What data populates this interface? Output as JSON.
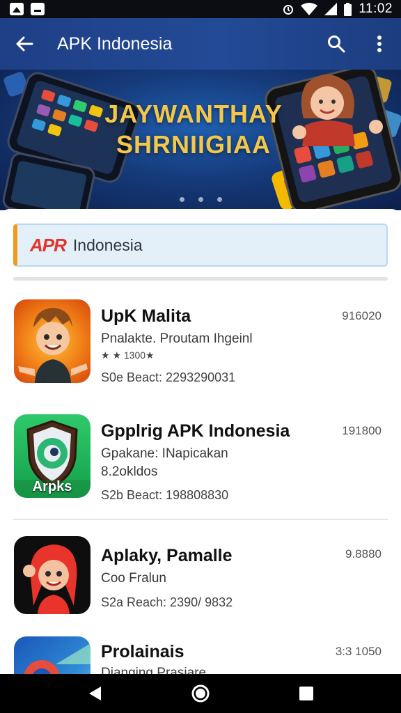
{
  "status_bar": {
    "time": "11:02",
    "left_icons": [
      "image-icon",
      "message-icon"
    ],
    "right_icons": [
      "alarm-icon",
      "wifi-icon",
      "signal-icon",
      "battery-icon"
    ]
  },
  "app_bar": {
    "title": "APK Indonesia",
    "back_icon": "arrow-back-icon",
    "search_icon": "search-icon",
    "menu_icon": "more-vert-icon",
    "color": "#234a96"
  },
  "banner": {
    "title_line1": "JAYWANTHAY",
    "title_line2": "SHRNIIGIAA",
    "page_dots": 3
  },
  "search": {
    "logo": "APR",
    "text": "Indonesia",
    "accent": "#f19a1b"
  },
  "apps": [
    {
      "name": "UpK Malita",
      "subtitle": "Pnalakte. Proutam Ihgeinl",
      "rating": "★ ★ 1300★",
      "meta": "S0e Beact: 2293290031",
      "size": "916020"
    },
    {
      "name": "Gpplrig APK Indonesia",
      "subtitle": "Gpakane: INapicakan",
      "subtitle2": "8.2okldos",
      "meta": "S2b Beact: 198808830",
      "size": "191800",
      "icon_label": "Arpks"
    },
    {
      "name": "Aplaky, Pamalle",
      "subtitle": "Coo Fralun",
      "meta": "S2a Reach: 2390/ 9832",
      "size": "9.8880"
    },
    {
      "name": "Prolainais",
      "subtitle": "Dianging Prasiare",
      "size": "3:3 1050"
    }
  ],
  "nav_bar": {
    "icons": [
      "back-triangle-icon",
      "home-circle-icon",
      "recents-square-icon"
    ]
  }
}
